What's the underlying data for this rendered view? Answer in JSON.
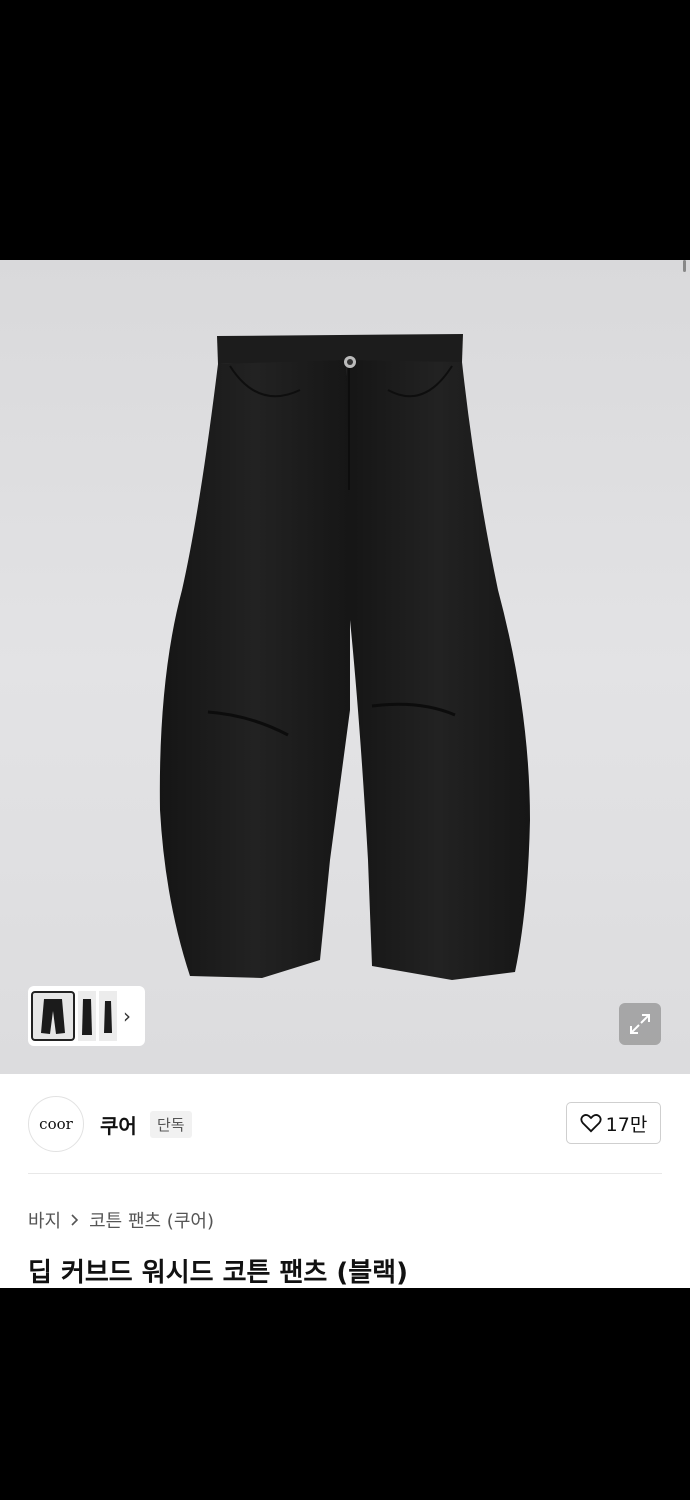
{
  "brand": {
    "logo_text": "coor",
    "name": "쿠어",
    "badge": "단독"
  },
  "like": {
    "count": "17만"
  },
  "breadcrumb": {
    "category": "바지",
    "subcategory": "코튼 팬츠 (쿠어)"
  },
  "product": {
    "title": "딥 커브드 워시드 코튼 팬츠 (블랙)"
  },
  "icons": {
    "like": "heart-icon",
    "breadcrumb_separator": "chevron-right-icon",
    "zoom": "expand-icon",
    "thumb_next": "chevron-right-icon"
  },
  "colors": {
    "hero_bg": "#dfdfe1",
    "product": "#1b1b1b",
    "text": "#111111",
    "muted": "#555555"
  }
}
